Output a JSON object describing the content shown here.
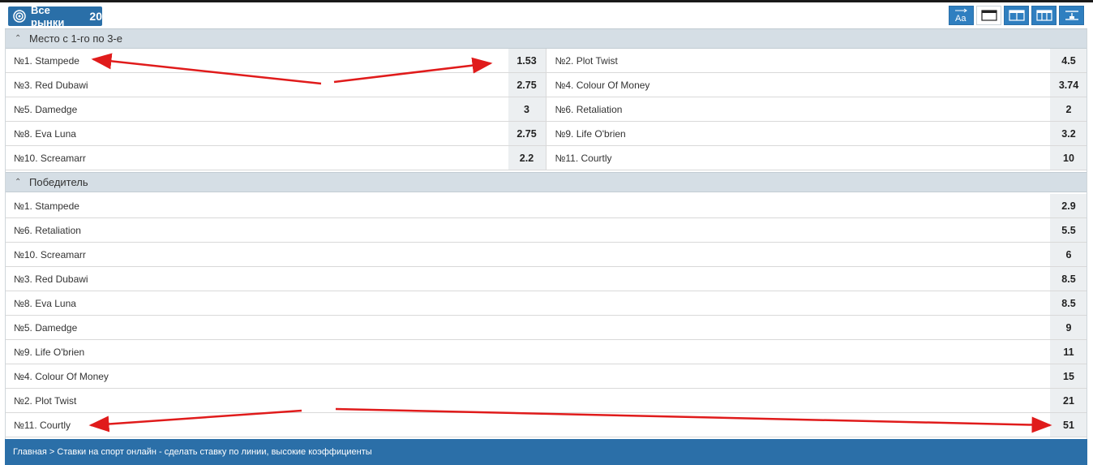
{
  "toolbar": {
    "all_markets_label": "Все рынки",
    "all_markets_count": "20",
    "tool_icons": [
      "font-size-icon",
      "single-column-icon",
      "two-column-icon",
      "three-column-icon",
      "collapse-icon"
    ],
    "font_tool_text": "Aa"
  },
  "sections": [
    {
      "title": "Место с 1-го по 3-е",
      "rows": [
        {
          "left": {
            "name": "№1. Stampede",
            "odd": "1.53"
          },
          "right": {
            "name": "№2. Plot Twist",
            "odd": "4.5"
          }
        },
        {
          "left": {
            "name": "№3. Red Dubawi",
            "odd": "2.75"
          },
          "right": {
            "name": "№4. Colour Of Money",
            "odd": "3.74"
          }
        },
        {
          "left": {
            "name": "№5. Damedge",
            "odd": "3"
          },
          "right": {
            "name": "№6. Retaliation",
            "odd": "2"
          }
        },
        {
          "left": {
            "name": "№8. Eva Luna",
            "odd": "2.75"
          },
          "right": {
            "name": "№9. Life O'brien",
            "odd": "3.2"
          }
        },
        {
          "left": {
            "name": "№10. Screamarr",
            "odd": "2.2"
          },
          "right": {
            "name": "№11. Courtly",
            "odd": "10"
          }
        }
      ]
    },
    {
      "title": "Победитель",
      "rows": [
        {
          "name": "№1. Stampede",
          "odd": "2.9"
        },
        {
          "name": "№6. Retaliation",
          "odd": "5.5"
        },
        {
          "name": "№10. Screamarr",
          "odd": "6"
        },
        {
          "name": "№3. Red Dubawi",
          "odd": "8.5"
        },
        {
          "name": "№8. Eva Luna",
          "odd": "8.5"
        },
        {
          "name": "№5. Damedge",
          "odd": "9"
        },
        {
          "name": "№9. Life O'brien",
          "odd": "11"
        },
        {
          "name": "№4. Colour Of Money",
          "odd": "15"
        },
        {
          "name": "№2. Plot Twist",
          "odd": "21"
        },
        {
          "name": "№11. Courtly",
          "odd": "51"
        }
      ]
    }
  ],
  "footer": {
    "breadcrumb": "Главная > Ставки на спорт онлайн - сделать ставку по линии, высокие коэффициенты"
  },
  "colors": {
    "accent": "#2b6fa8",
    "section_header": "#d5dee5",
    "annotation_arrow": "#e01b1b"
  }
}
